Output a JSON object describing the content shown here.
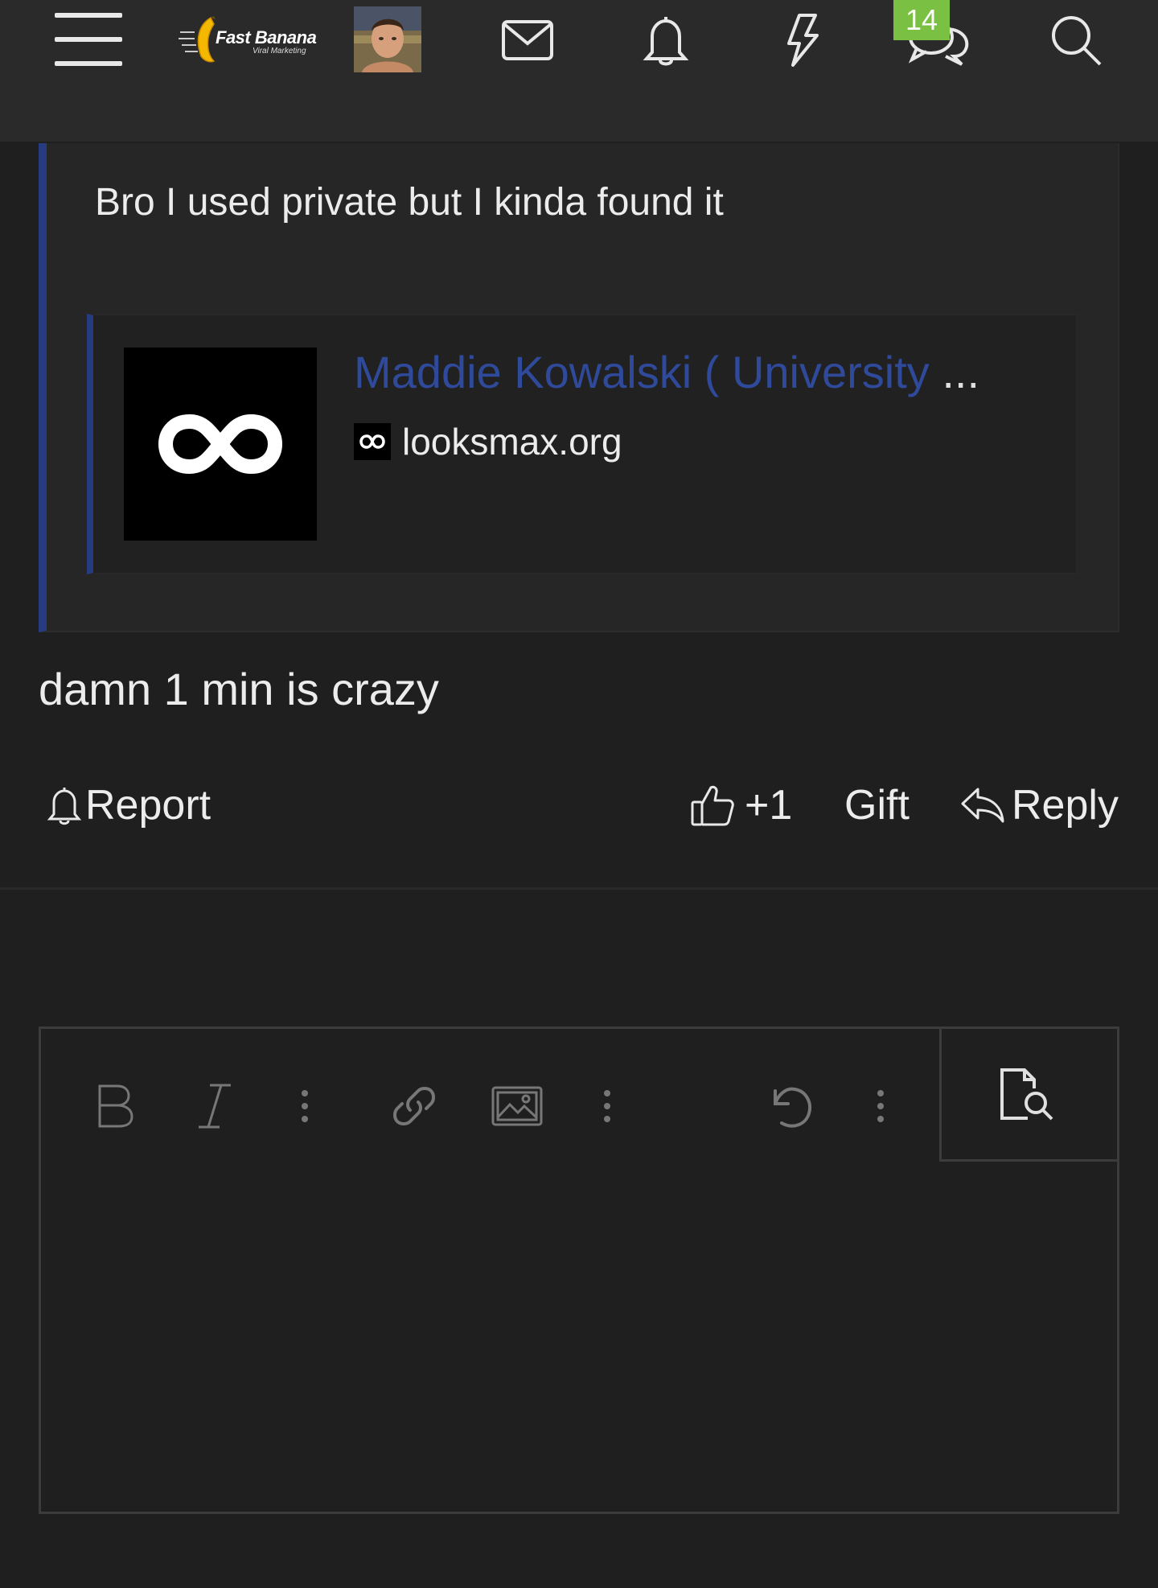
{
  "header": {
    "menu_icon": "hamburger-icon",
    "logo": {
      "brand": "Fast Banana",
      "tagline": "Viral Marketing"
    },
    "icons": [
      "envelope-icon",
      "bell-icon",
      "bolt-icon",
      "chat-bubbles-icon",
      "search-icon"
    ],
    "chat_badge": "14",
    "badge_color": "#7ac143"
  },
  "quote": {
    "text": "Bro I used private but I kinda found it",
    "accent_color": "#263b80",
    "embed": {
      "title": "Maddie Kowalski ( University",
      "ellipsis": "...",
      "site": "looksmax.org",
      "title_color": "#2f4a9a"
    }
  },
  "post": {
    "text": "damn 1 min is crazy"
  },
  "actions": {
    "report": "Report",
    "like": "+1",
    "gift": "Gift",
    "reply": "Reply"
  },
  "editor": {
    "toolbar": [
      "bold-icon",
      "italic-icon",
      "more-text-icon",
      "link-icon",
      "image-icon",
      "more-insert-icon",
      "undo-icon",
      "more-icon",
      "preview-icon"
    ]
  }
}
